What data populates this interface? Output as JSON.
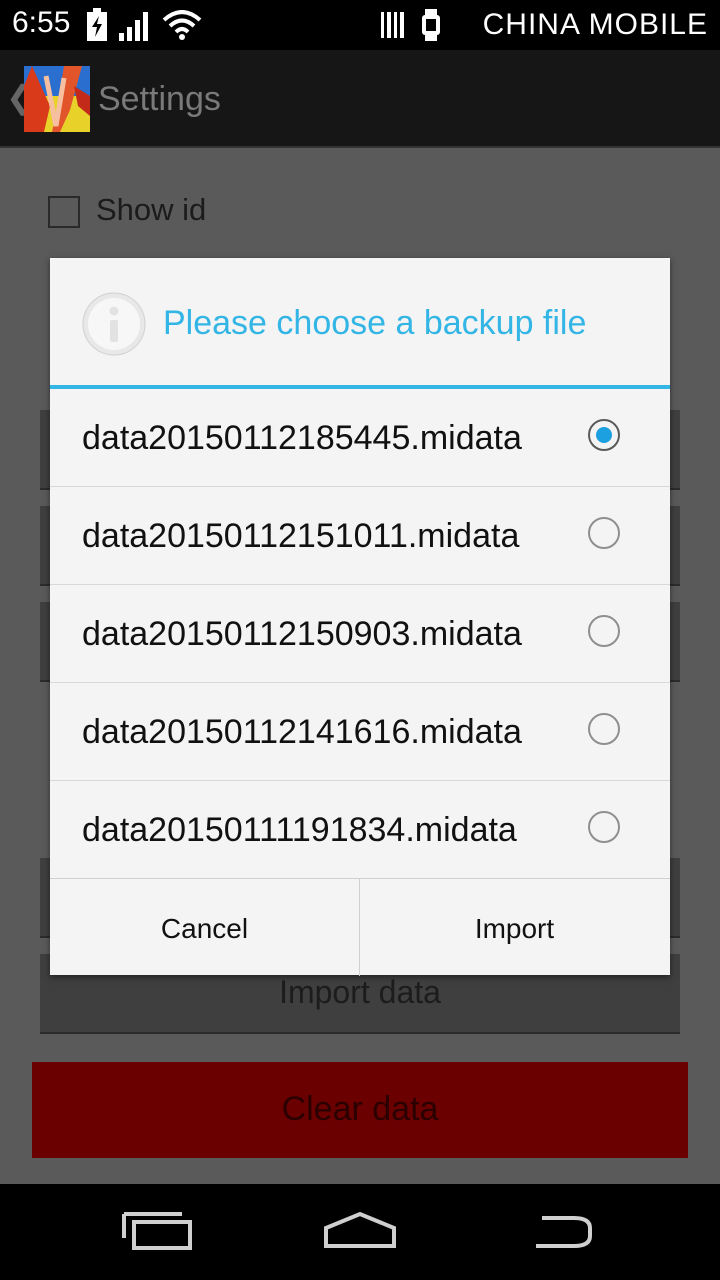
{
  "status_bar": {
    "time": "6:55",
    "carrier": "CHINA  MOBILE",
    "icons": [
      "battery-charging-icon",
      "signal-icon",
      "wifi-icon",
      "barcode-icon",
      "watch-icon"
    ]
  },
  "action_bar": {
    "title": "Settings",
    "back_icon": "chevron-left-icon"
  },
  "settings": {
    "show_id_label": "Show id",
    "show_id_checked": false,
    "import_button_label": "Import data",
    "clear_button_label": "Clear data"
  },
  "dialog": {
    "title": "Please choose a backup file",
    "icon": "info-icon",
    "options": [
      {
        "label": "data20150112185445.midata",
        "selected": true
      },
      {
        "label": "data20150112151011.midata",
        "selected": false
      },
      {
        "label": "data20150112150903.midata",
        "selected": false
      },
      {
        "label": "data20150112141616.midata",
        "selected": false
      },
      {
        "label": "data20150111191834.midata",
        "selected": false
      }
    ],
    "cancel_label": "Cancel",
    "import_label": "Import"
  },
  "nav_bar": {
    "icons": [
      "recent-apps-icon",
      "home-icon",
      "back-icon"
    ]
  },
  "colors": {
    "accent": "#33b5e5",
    "clear_button": "#6b0000"
  }
}
